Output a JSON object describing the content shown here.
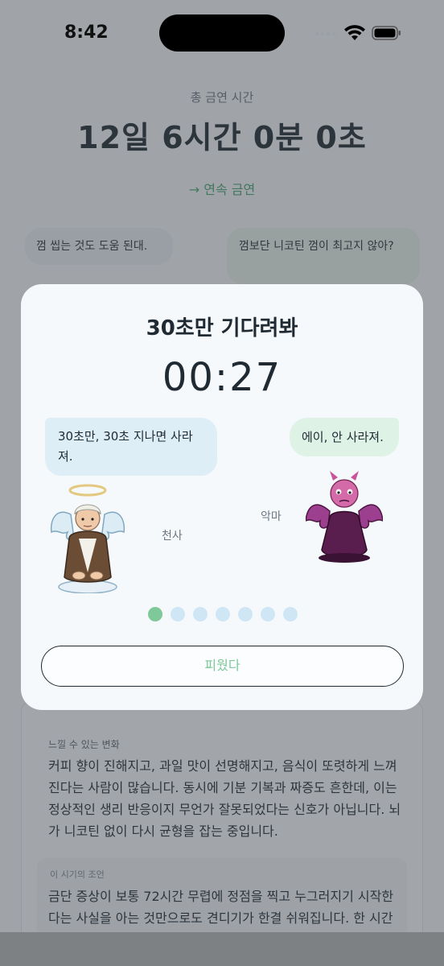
{
  "status_bar": {
    "time": "8:42"
  },
  "background": {
    "total_label": "총 금연 시간",
    "total_time": "12일 6시간 0분 0초",
    "streak_link": "→ 연속 금연",
    "bubble_left": "껌 씹는 것도 도움 된대.",
    "bubble_right": "껌보단 니코틴 껌이 최고지 않아?",
    "change_label": "느낄 수 있는 변화",
    "change_text": "커피 향이 진해지고, 과일 맛이 선명해지고, 음식이 또렷하게 느껴진다는 사람이 많습니다. 동시에 기분 기복과 짜증도 흔한데, 이는 정상적인 생리 반응이지 무언가 잘못되었다는 신호가 아닙니다. 뇌가 니코틴 없이 다시 균형을 잡는 중입니다.",
    "tip_label": "이 시기의 조언",
    "tip_text": "금단 증상이 보통 72시간 무렵에 정점을 찍고 누그러지기 시작한다는 사실을 아는 것만으로도 견디기가 한결 쉬워집니다. 한 시간"
  },
  "modal": {
    "title": "30초만 기다려봐",
    "countdown": "00:27",
    "angel_bubble": "30초만, 30초 지나면 사라져.",
    "devil_bubble": "에이, 안 사라져.",
    "angel_name": "천사",
    "devil_name": "악마",
    "progress": {
      "current": 1,
      "total": 7
    },
    "avoid_button": "피웠다"
  },
  "colors": {
    "accent": "#7ec89a",
    "dot_inactive": "#cfe6f5",
    "link": "#4aa773"
  }
}
